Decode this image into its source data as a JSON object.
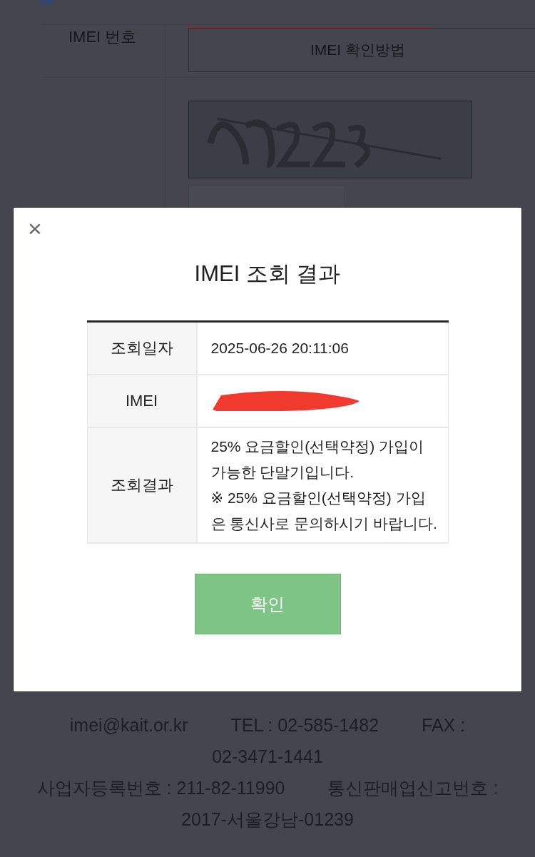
{
  "page": {
    "form": {
      "label": "IMEI 번호",
      "help_button": "IMEI 확인방법",
      "refresh_button": {
        "kind": "button"
      }
    },
    "footer": {
      "lines": [
        [
          "imei@kait.or.kr",
          "TEL : 02-585-1482",
          "FAX :"
        ],
        [
          "02-3471-1441"
        ],
        [
          "사업자등록번호 : 211-82-11990",
          "통신판매업신고번호 :"
        ],
        [
          "2017-서울강남-01239"
        ]
      ]
    }
  },
  "modal": {
    "close": "×",
    "title": "IMEI 조회 결과",
    "rows": [
      {
        "label": "조회일자",
        "value": "2025-06-26 20:11:06"
      },
      {
        "label": "IMEI",
        "redacted": true
      },
      {
        "label": "조회결과",
        "value": "25% 요금할인(선택약정) 가입이 가능한 단말기입니다.\n※ 25% 요금할인(선택약정) 가입은 통신사로 문의하시기 바랍니다."
      }
    ],
    "confirm_button": "확인"
  }
}
